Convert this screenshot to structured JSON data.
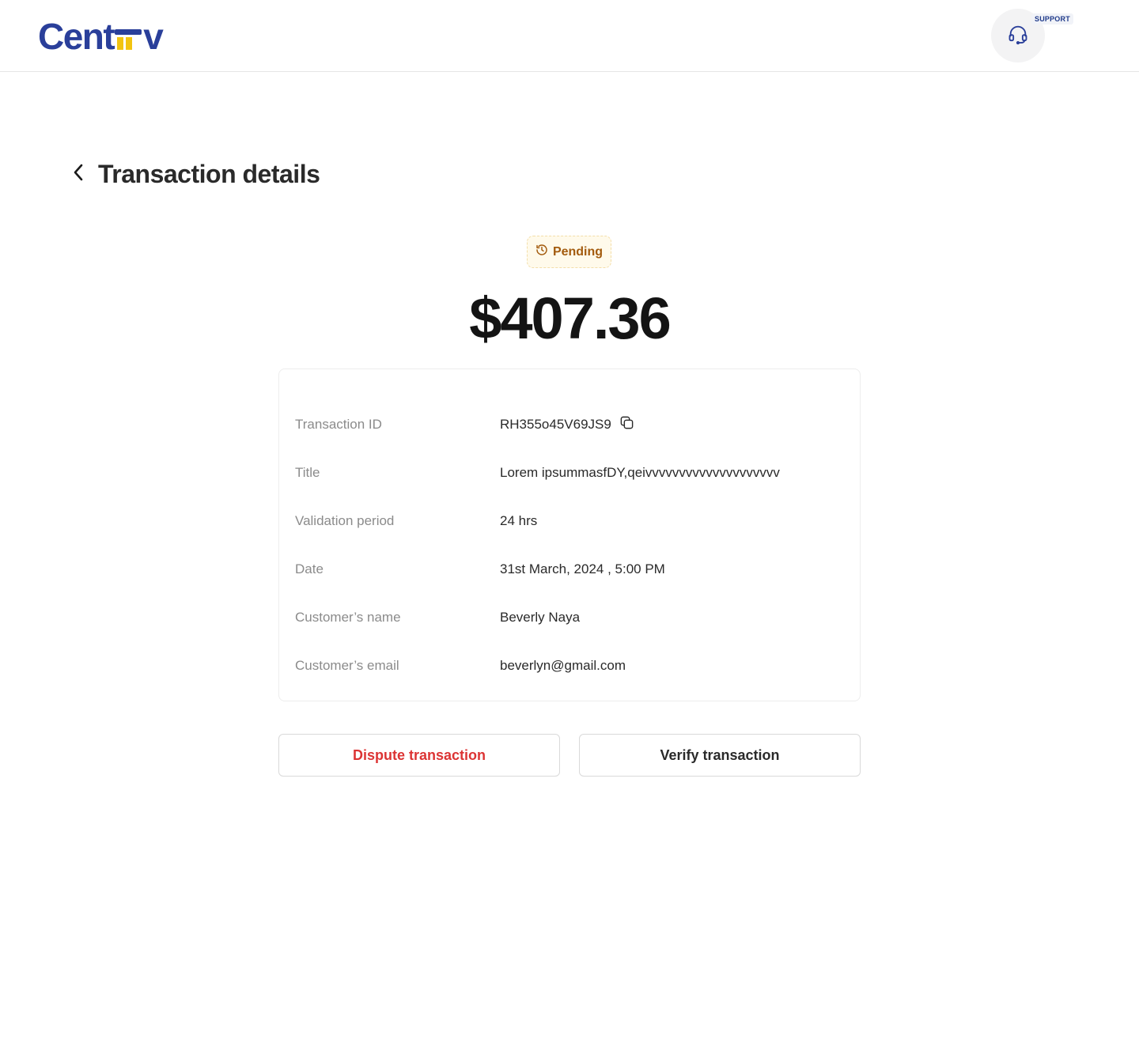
{
  "header": {
    "logo_text": "Cent",
    "logo_suffix": "v",
    "support_label": "SUPPORT"
  },
  "page": {
    "title": "Transaction details"
  },
  "transaction": {
    "status": "Pending",
    "amount": "$407.36",
    "details": [
      {
        "label": "Transaction ID",
        "value": "RH355o45V69JS9"
      },
      {
        "label": "Title",
        "value": "Lorem ipsummasfDY,qeivvvvvvvvvvvvvvvvvvvv"
      },
      {
        "label": "Validation period",
        "value": "24 hrs"
      },
      {
        "label": "Date",
        "value": "31st March, 2024 , 5:00 PM"
      },
      {
        "label": "Customer’s name",
        "value": "Beverly Naya"
      },
      {
        "label": "Customer’s email",
        "value": "beverlyn@gmail.com"
      }
    ]
  },
  "actions": {
    "dispute_label": "Dispute transaction",
    "verify_label": "Verify transaction"
  },
  "colors": {
    "brand": "#2a3f9a",
    "brand_accent": "#f2c40f",
    "pending_text": "#a35b0e",
    "pending_bg": "#fffaeb",
    "danger": "#dc3434"
  },
  "icons": {
    "support": "headset-icon",
    "back": "chevron-left-icon",
    "status": "clock-history-icon",
    "copy": "copy-icon"
  }
}
